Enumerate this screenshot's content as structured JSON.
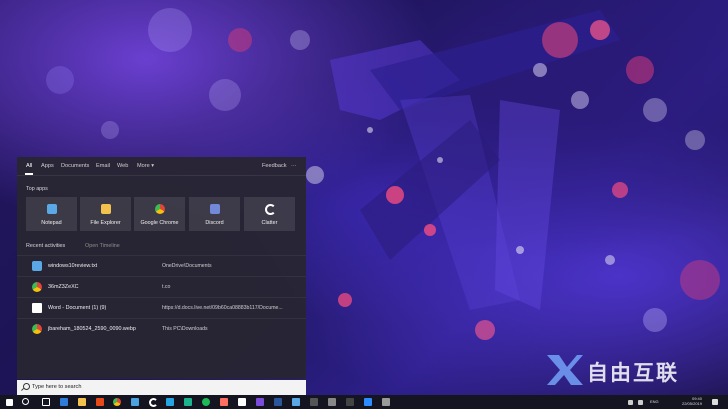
{
  "search": {
    "tabs": [
      "All",
      "Apps",
      "Documents",
      "Email",
      "Web",
      "More ▾"
    ],
    "feedback": "Feedback",
    "more_dots": "···",
    "top_apps_label": "Top apps",
    "apps": [
      {
        "label": "Notepad",
        "icon": "notepad-icon",
        "color": "#5aa9e6"
      },
      {
        "label": "File Explorer",
        "icon": "folder-icon",
        "color": "#f2c14e"
      },
      {
        "label": "Google Chrome",
        "icon": "chrome-icon",
        "color": "#e0463a"
      },
      {
        "label": "Discord",
        "icon": "discord-icon",
        "color": "#7289da"
      },
      {
        "label": "Clatter",
        "icon": "clatter-icon",
        "color": "#ffffff"
      }
    ],
    "recent_label": "Recent activities",
    "open_timeline": "Open Timeline",
    "recent": [
      {
        "name": "windows10review.txt",
        "location": "OneDrive\\Documents",
        "icon": "notepad-icon",
        "color": "#5aa9e6"
      },
      {
        "name": "36mZ3ZeXC",
        "location": "t.co",
        "icon": "chrome-icon",
        "color": "#e0463a"
      },
      {
        "name": "Word - Document (1) (9)",
        "location": "https://d.docs.live.net/09b60ca08883b117/Docume...",
        "icon": "word-doc-icon",
        "color": "#ffffff"
      },
      {
        "name": "jbareham_180524_2590_0090.webp",
        "location": "This PC\\Downloads",
        "icon": "chrome-icon",
        "color": "#e0463a"
      }
    ],
    "placeholder": "Type here to search"
  },
  "taskbar": {
    "time": "09:40",
    "date": "22/05/2019",
    "lang": "ENG"
  },
  "watermark": "自由互联"
}
